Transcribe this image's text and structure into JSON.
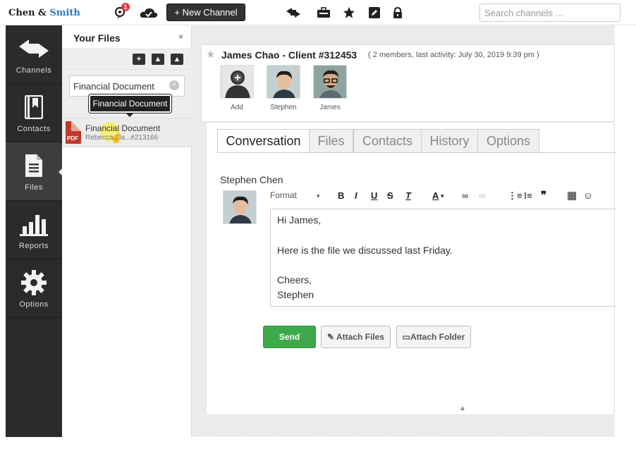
{
  "app": {
    "logo_part1": "Chen &",
    "logo_part2": "Smith",
    "notification_count": "1",
    "new_channel_label": "+ New Channel",
    "search_placeholder": "Search channels ..."
  },
  "toolbar_icons": [
    "notifications-icon",
    "cloud-icon",
    "transfer-icon",
    "briefcase-icon",
    "star-icon",
    "edit-icon",
    "lock-icon"
  ],
  "nav": {
    "items": [
      {
        "label": "Channels",
        "icon": "arrows-icon"
      },
      {
        "label": "Contacts",
        "icon": "contacts-book-icon"
      },
      {
        "label": "Files",
        "icon": "file-icon"
      },
      {
        "label": "Reports",
        "icon": "bar-chart-icon"
      },
      {
        "label": "Options",
        "icon": "gear-icon"
      }
    ],
    "active": "Files"
  },
  "files_panel": {
    "title": "Your Files",
    "close": "×",
    "search_value": "Financial Document",
    "clear": "×",
    "tooltip": "Financial Document",
    "file": {
      "type": "PDF",
      "name": "Financial Document",
      "sub": "Rebecca Tla...#213166"
    }
  },
  "channel": {
    "title": "James Chao - Client #312453",
    "meta": "( 2 members, last activity: July 30, 2019 9:39 pm )",
    "members": [
      {
        "name": "Add"
      },
      {
        "name": "Stephen"
      },
      {
        "name": "James"
      }
    ]
  },
  "tabs": [
    {
      "label": "Conversation",
      "active": true
    },
    {
      "label": "Files",
      "active": false
    },
    {
      "label": "Contacts",
      "active": false
    },
    {
      "label": "History",
      "active": false
    },
    {
      "label": "Options",
      "active": false
    }
  ],
  "message": {
    "author": "Stephen Chen",
    "format_label": "Format",
    "lines": [
      "Hi James,",
      "Here is the file we discussed last Friday.",
      "Cheers,",
      "Stephen"
    ]
  },
  "actions": {
    "send": "Send",
    "attach_files": "Attach Files",
    "attach_folder": "Attach Folder"
  },
  "colors": {
    "nav_bg": "#2b2b2b",
    "send_green": "#3ca94a",
    "pdf_red": "#c0392b",
    "logo_blue": "#2a7ac4"
  }
}
